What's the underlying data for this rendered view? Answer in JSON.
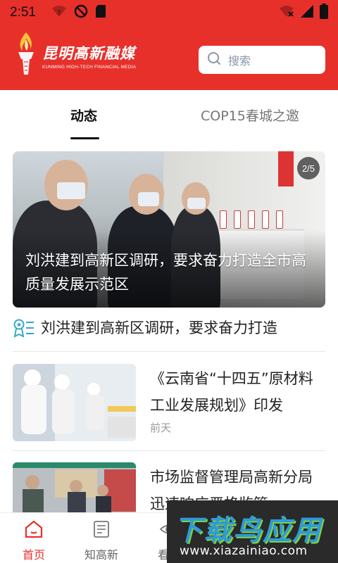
{
  "status_bar": {
    "time": "2:51",
    "left_icons": [
      "wifi-question-icon",
      "do-not-disturb-icon",
      "sd-card-icon"
    ],
    "right_icons": [
      "wifi-off-icon",
      "signal-icon",
      "battery-icon"
    ]
  },
  "header": {
    "logo_cn": "昆明高新融媒",
    "logo_en": "KUNMING HIGH-TECH FINANCIAL MEDIA",
    "search_placeholder": "搜索",
    "bg_color": "#e8302b"
  },
  "tabs": [
    {
      "label": "动态",
      "active": true
    },
    {
      "label": "COP15春城之邀",
      "active": false
    }
  ],
  "carousel": {
    "title": "刘洪建到高新区调研，要求奋力打造全市高质量发展示范区",
    "page_indicator": "2/5"
  },
  "ticker": {
    "icon": "award-list-icon",
    "text": "刘洪建到高新区调研，要求奋力打造"
  },
  "news": [
    {
      "title": "《云南省“十四五”原材料工业发展规划》印发",
      "time": "前天"
    },
    {
      "title": "市场监督管理局高新分局迅速响应严格监管",
      "time": ""
    }
  ],
  "bottom_nav": [
    {
      "label": "首页",
      "icon": "home-icon",
      "active": true
    },
    {
      "label": "知高新",
      "icon": "news-paper-icon",
      "active": false
    },
    {
      "label": "看高",
      "icon": "eye-icon",
      "active": false
    }
  ],
  "watermark": {
    "cn": "下载鸟应用",
    "en": "www.xiazainiao.com"
  }
}
